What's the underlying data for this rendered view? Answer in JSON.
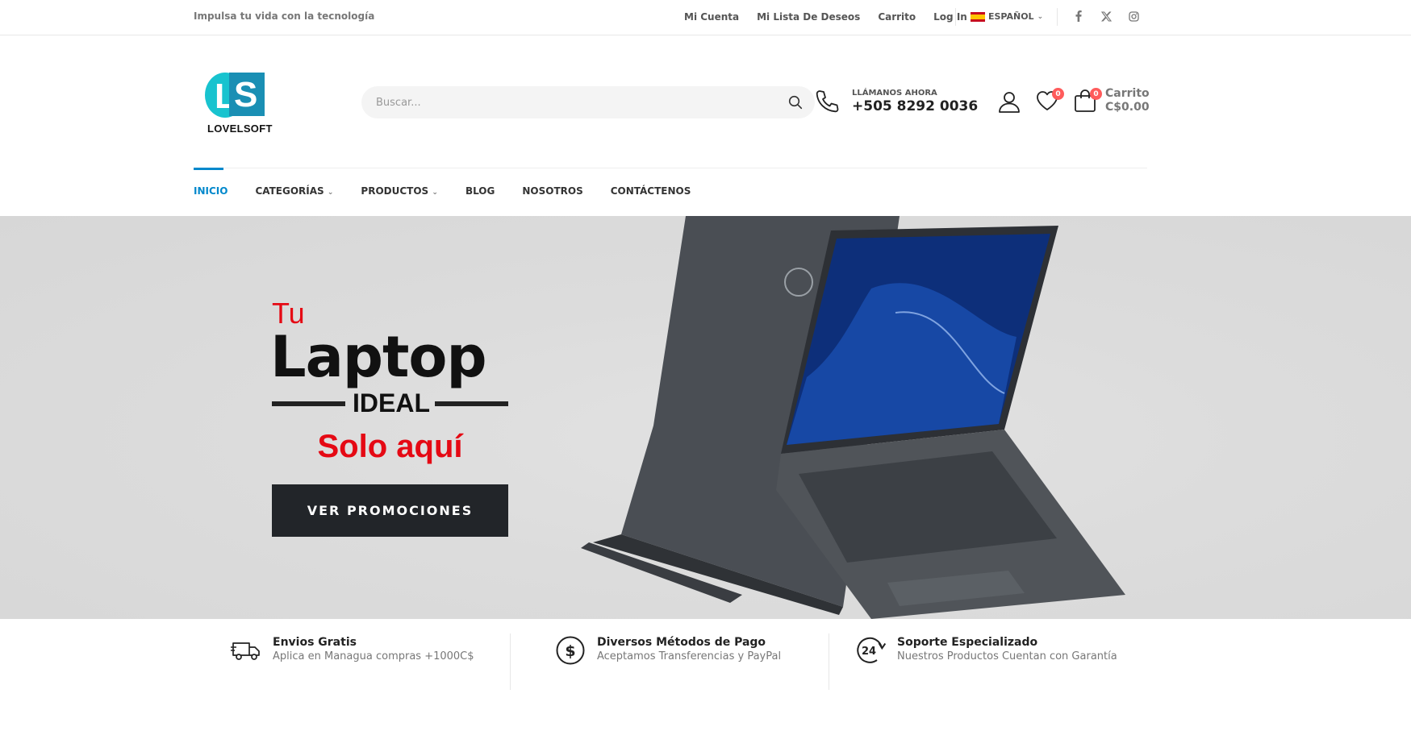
{
  "topbar": {
    "tagline": "Impulsa tu vida con la tecnología",
    "links": [
      "Mi Cuenta",
      "Mi Lista De Deseos",
      "Carrito",
      "Log In"
    ],
    "language": "ESPAÑOL",
    "social_icons": [
      "facebook-icon",
      "x-twitter-icon",
      "instagram-icon"
    ]
  },
  "header": {
    "logo_letters": [
      "L",
      "S"
    ],
    "logo_text": "LOVELSOFT",
    "search_placeholder": "Buscar...",
    "call_label": "LLÁMANOS AHORA",
    "phone": "+505 8292 0036",
    "wishlist_count": "0",
    "cart_count": "0",
    "cart_label": "Carrito",
    "cart_total": "C$0.00"
  },
  "nav": {
    "items": [
      {
        "label": "INICIO",
        "active": true
      },
      {
        "label": "CATEGORÍAS",
        "dropdown": true
      },
      {
        "label": "PRODUCTOS",
        "dropdown": true
      },
      {
        "label": "BLOG"
      },
      {
        "label": "NOSOTROS"
      },
      {
        "label": "CONTÁCTENOS"
      }
    ]
  },
  "hero": {
    "line1": "Tu",
    "line2": "Laptop",
    "line3": "IDEAL",
    "line4": "Solo aquí",
    "cta": "VER PROMOCIONES"
  },
  "features": [
    {
      "icon": "truck-icon",
      "title": "Envios Gratis",
      "subtitle": "Aplica en Managua compras +1000C$"
    },
    {
      "icon": "dollar-circle-icon",
      "title": "Diversos Métodos de Pago",
      "subtitle": "Aceptamos Transferencias y PayPal"
    },
    {
      "icon": "support-24-icon",
      "title": "Soporte Especializado",
      "subtitle": "Nuestros Productos Cuentan con Garantía"
    }
  ],
  "colors": {
    "accent": "#0188cc",
    "hero_red": "#e50914",
    "button_dark": "#222529",
    "badge": "#ff5b5b",
    "logo_cyan": "#18c3cf",
    "logo_blue": "#1a8fb4"
  }
}
